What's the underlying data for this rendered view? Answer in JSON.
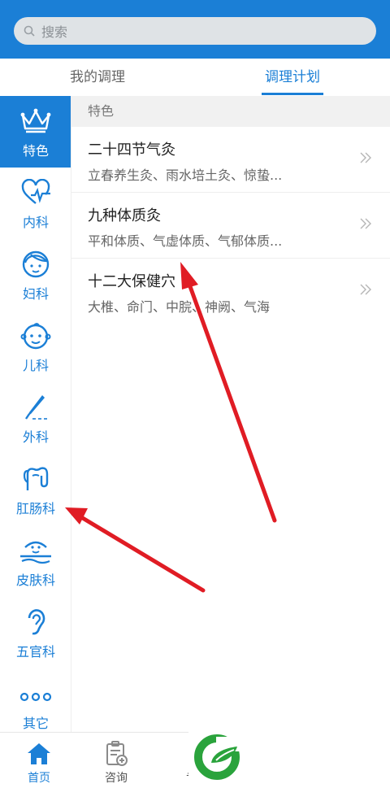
{
  "search": {
    "placeholder": "搜索"
  },
  "tabs": [
    {
      "label": "我的调理",
      "active": false
    },
    {
      "label": "调理计划",
      "active": true
    }
  ],
  "sidebar": {
    "items": [
      {
        "label": "特色",
        "icon": "crown-icon",
        "active": true
      },
      {
        "label": "内科",
        "icon": "heart-pulse-icon"
      },
      {
        "label": "妇科",
        "icon": "woman-face-icon"
      },
      {
        "label": "儿科",
        "icon": "baby-face-icon"
      },
      {
        "label": "外科",
        "icon": "scalpel-icon"
      },
      {
        "label": "肛肠科",
        "icon": "intestine-icon"
      },
      {
        "label": "皮肤科",
        "icon": "skin-icon"
      },
      {
        "label": "五官科",
        "icon": "ear-icon"
      },
      {
        "label": "其它",
        "icon": "more-dots-icon"
      }
    ]
  },
  "content": {
    "section_title": "特色",
    "rows": [
      {
        "title": "二十四节气灸",
        "subtitle": "立春养生灸、雨水培土灸、惊蛰..."
      },
      {
        "title": "九种体质灸",
        "subtitle": "平和体质、气虚体质、气郁体质..."
      },
      {
        "title": "十二大保健穴",
        "subtitle": "大椎、命门、中脘、神阙、气海"
      }
    ]
  },
  "bottom_nav": [
    {
      "label": "首页",
      "icon": "home-icon",
      "active": true
    },
    {
      "label": "咨询",
      "icon": "consult-clipboard-icon"
    },
    {
      "label": "专",
      "icon": "search-person-icon"
    }
  ],
  "colors": {
    "accent": "#1b7fd6",
    "arrow": "#e01c24",
    "logo": "#2aa33c"
  }
}
